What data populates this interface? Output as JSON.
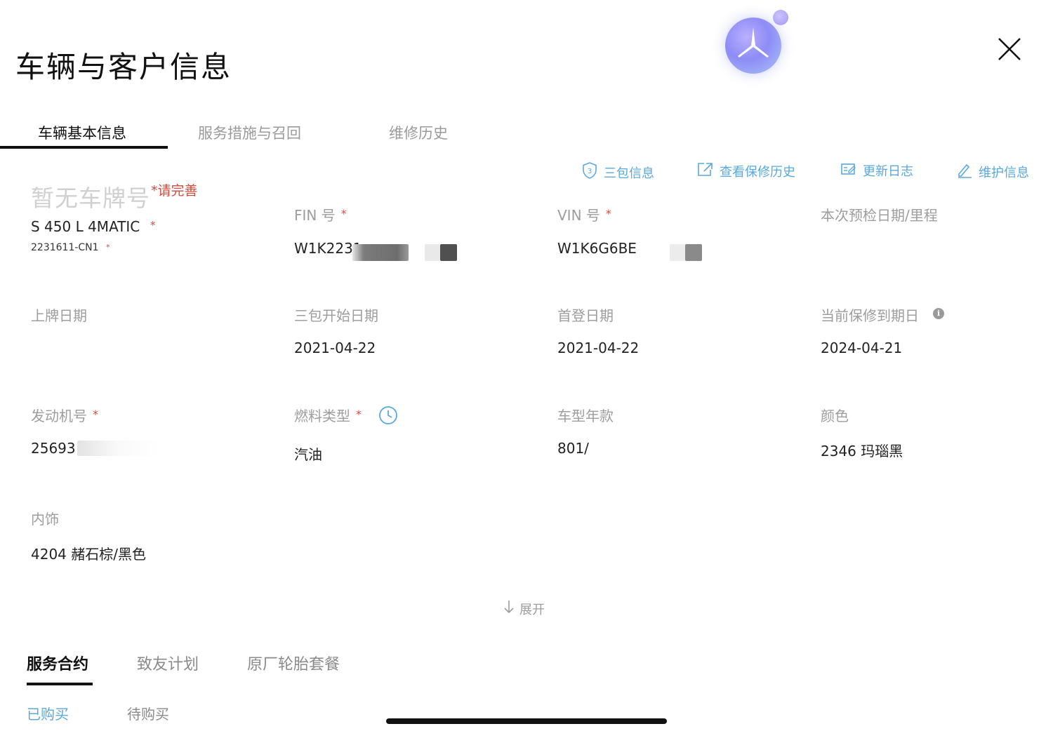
{
  "header": {
    "title": "车辆与客户信息"
  },
  "tabs": [
    {
      "label": "车辆基本信息",
      "active": true
    },
    {
      "label": "服务措施与召回",
      "active": false
    },
    {
      "label": "维修历史",
      "active": false
    }
  ],
  "actions": [
    {
      "label": "三包信息",
      "icon": "shield-three-icon"
    },
    {
      "label": "查看保修历史",
      "icon": "external-link-icon"
    },
    {
      "label": "更新日志",
      "icon": "edit-log-icon"
    },
    {
      "label": "维护信息",
      "icon": "pencil-icon"
    }
  ],
  "vehicle": {
    "plate_placeholder": "暂无车牌号",
    "plate_required": "*请完善",
    "model": "S 450 L 4MATIC",
    "code": "2231611-CN1"
  },
  "fields": {
    "fin": {
      "label": "FIN 号",
      "value": "W1K2231"
    },
    "vin": {
      "label": "VIN 号",
      "value": "W1K6G6BE"
    },
    "inspection": {
      "label": "本次预检日期/里程",
      "value": ""
    },
    "plate_date": {
      "label": "上牌日期",
      "value": ""
    },
    "warranty_start": {
      "label": "三包开始日期",
      "value": "2021-04-22"
    },
    "first_reg": {
      "label": "首登日期",
      "value": "2021-04-22"
    },
    "warranty_end": {
      "label": "当前保修到期日",
      "value": "2024-04-21"
    },
    "engine": {
      "label": "发动机号",
      "value": "25693"
    },
    "fuel": {
      "label": "燃料类型",
      "value": "汽油"
    },
    "model_year": {
      "label": "车型年款",
      "value": "801/"
    },
    "color": {
      "label": "颜色",
      "value": "2346 玛瑙黑"
    },
    "interior": {
      "label": "内饰",
      "value": "4204 赭石棕/黑色"
    }
  },
  "required_mark": "*",
  "expand_label": "展开",
  "sub_tabs": [
    {
      "label": "服务合约",
      "active": true
    },
    {
      "label": "致友计划",
      "active": false
    },
    {
      "label": "原厂轮胎套餐",
      "active": false
    }
  ],
  "sub_sub_tabs": [
    {
      "label": "已购买",
      "active": true
    },
    {
      "label": "待购买",
      "active": false
    }
  ],
  "colors": {
    "accent": "#5aa8df",
    "required": "#d24a3a",
    "label": "#9d9d9d"
  }
}
